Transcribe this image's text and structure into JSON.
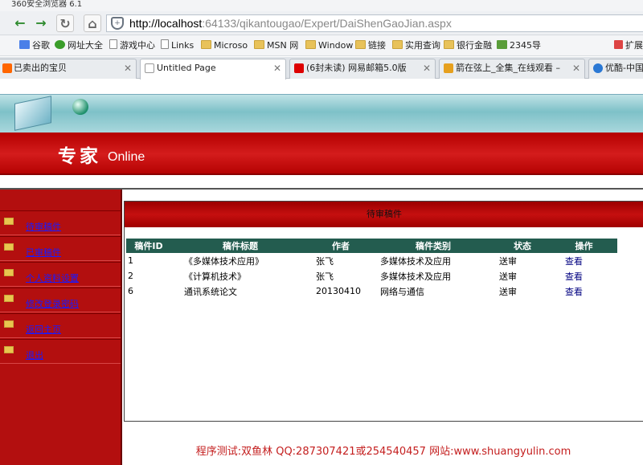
{
  "window": {
    "title": "360安全浏览器 6.1"
  },
  "address": {
    "host": "http://localhost",
    "path": ":64133/qikantougao/Expert/DaiShenGaoJian.aspx"
  },
  "bookmarks": [
    "谷歌",
    "网址大全",
    "游戏中心",
    "Links",
    "Microso",
    "MSN 网",
    "Window",
    "链接",
    "实用查询",
    "银行金融",
    "2345导",
    "扩展"
  ],
  "tabs": [
    {
      "label": "已卖出的宝贝"
    },
    {
      "label": "Untitled Page"
    },
    {
      "label": "(6封未读) 网易邮箱5.0版"
    },
    {
      "label": "箭在弦上_全集_在线观看 –"
    },
    {
      "label": "优酷-中国"
    }
  ],
  "header": {
    "logo": "专家",
    "logo_suffix": "Online"
  },
  "sidebar": {
    "items": [
      {
        "label": "待审稿件"
      },
      {
        "label": "已审稿件"
      },
      {
        "label": "个人资料设置"
      },
      {
        "label": "修改登录密码"
      },
      {
        "label": "返回主页"
      },
      {
        "label": "退出"
      }
    ]
  },
  "main": {
    "title": "待审稿件",
    "columns": [
      "稿件ID",
      "稿件标题",
      "作者",
      "稿件类别",
      "状态",
      "操作"
    ],
    "rows": [
      {
        "id": "1",
        "title": "《多媒体技术应用》",
        "author": "张飞",
        "category": "多媒体技术及应用",
        "status": "送审",
        "action": "查看"
      },
      {
        "id": "2",
        "title": "《计算机技术》",
        "author": "张飞",
        "category": "多媒体技术及应用",
        "status": "送审",
        "action": "查看"
      },
      {
        "id": "6",
        "title": "通讯系统论文",
        "author": "20130410",
        "category": "网络与通信",
        "status": "送审",
        "action": "查看"
      }
    ]
  },
  "footer": {
    "text": "程序测试:双鱼林 QQ:287307421或254540457 网站:www.shuangyulin.com"
  }
}
